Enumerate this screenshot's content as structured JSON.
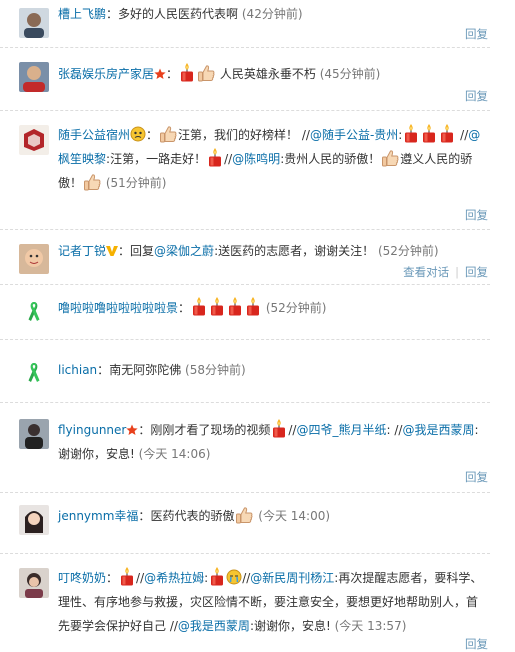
{
  "colors": {
    "link": "#0a6ea8",
    "reply": "#6a98b8",
    "divider": "#dcdcdc"
  },
  "reply_label": "回复",
  "view_conversation_label": "查看对话",
  "comments": [
    {
      "user": "槽上飞鹏",
      "text": "多好的人民医药代表啊",
      "time": "(42分钟前)",
      "avatar": "portrait-avatar"
    },
    {
      "user": "张磊娱乐房产家居",
      "text": "人民英雄永垂不朽",
      "time": "(45分钟前)",
      "avatar": "portrait-avatar"
    },
    {
      "user": "随手公益宿州",
      "text1": "汪第，我们的好榜样！",
      "mention1": "@随手公益-贵州",
      "mention2": "@枫笙映黎",
      "text2": "汪第，一路走好！",
      "mention3": "@陈鸣明",
      "text3": "贵州人民的骄傲！",
      "text4": "遵义人民的骄傲！",
      "time": "(51分钟前)",
      "avatar": "red-logo-avatar"
    },
    {
      "user": "记者丁锐",
      "reply_prefix": "回复",
      "mention": "@梁伽之蔚",
      "text": "送医药的志愿者，谢谢关注！",
      "time": "(52分钟前)",
      "avatar": "child-avatar"
    },
    {
      "user": "噜啦啦噜啦啦啦啦啦景",
      "time": "(52分钟前)",
      "avatar": "green-ribbon-icon"
    },
    {
      "user": "lichian",
      "text": "南无阿弥陀佛",
      "time": "(58分钟前)",
      "avatar": "green-ribbon-icon"
    },
    {
      "user": "flyingunner",
      "text1": "刚刚才看了现场的视频",
      "mention1": "@四爷_熊月半纸",
      "mention2": "@我是西蒙周",
      "text2": "谢谢你，安息!",
      "time": "(今天 14:06)",
      "avatar": "portrait-avatar"
    },
    {
      "user": "jennymm幸福",
      "text": "医药代表的骄傲",
      "time": "(今天 14:00)",
      "avatar": "portrait-avatar"
    },
    {
      "user": "叮咚奶奶",
      "mention1": "@希热拉姆",
      "mention2": "@新民周刊杨江",
      "text1": "再次提醒志愿者，要科",
      "text2": "学、理性、有序地参与救援，灾区险情不断，要注意安全，要想更好地帮助别",
      "text3": "人，首先要学会保护好自己",
      "mention3": "@我是西蒙周",
      "text4": "谢谢你，安息!",
      "time": "(今天 13:57)",
      "avatar": "portrait-avatar"
    }
  ]
}
